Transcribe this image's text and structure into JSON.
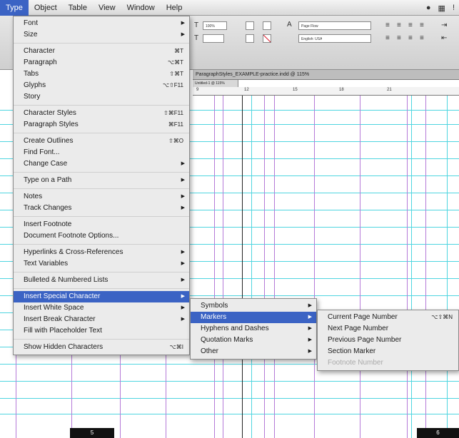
{
  "menubar": {
    "items": [
      "Type",
      "Object",
      "Table",
      "View",
      "Window",
      "Help"
    ],
    "active": "Type"
  },
  "control": {
    "size_value": "100%",
    "style_field": "Page Flow",
    "language_field": "English: USA"
  },
  "document": {
    "title": "ParagraphStyles_EXAMPLE-practice.indd @ 115%",
    "subtab": "Untitled-1 @ 115%",
    "ruler_numbers": [
      "9",
      "12",
      "15",
      "18",
      "21"
    ]
  },
  "pages": {
    "left_label": "5",
    "right_label": "6"
  },
  "type_menu": {
    "groups": [
      [
        {
          "label": "Font",
          "shortcut": "",
          "submenu": true
        },
        {
          "label": "Size",
          "shortcut": "",
          "submenu": true
        }
      ],
      [
        {
          "label": "Character",
          "shortcut": "⌘T",
          "submenu": false
        },
        {
          "label": "Paragraph",
          "shortcut": "⌥⌘T",
          "submenu": false
        },
        {
          "label": "Tabs",
          "shortcut": "⇧⌘T",
          "submenu": false
        },
        {
          "label": "Glyphs",
          "shortcut": "⌥⇧F11",
          "submenu": false
        },
        {
          "label": "Story",
          "shortcut": "",
          "submenu": false
        }
      ],
      [
        {
          "label": "Character Styles",
          "shortcut": "⇧⌘F11",
          "submenu": false
        },
        {
          "label": "Paragraph Styles",
          "shortcut": "⌘F11",
          "submenu": false
        }
      ],
      [
        {
          "label": "Create Outlines",
          "shortcut": "⇧⌘O",
          "submenu": false
        },
        {
          "label": "Find Font...",
          "shortcut": "",
          "submenu": false
        },
        {
          "label": "Change Case",
          "shortcut": "",
          "submenu": true
        }
      ],
      [
        {
          "label": "Type on a Path",
          "shortcut": "",
          "submenu": true
        }
      ],
      [
        {
          "label": "Notes",
          "shortcut": "",
          "submenu": true
        },
        {
          "label": "Track Changes",
          "shortcut": "",
          "submenu": true
        }
      ],
      [
        {
          "label": "Insert Footnote",
          "shortcut": "",
          "submenu": false
        },
        {
          "label": "Document Footnote Options...",
          "shortcut": "",
          "submenu": false
        }
      ],
      [
        {
          "label": "Hyperlinks & Cross-References",
          "shortcut": "",
          "submenu": true
        },
        {
          "label": "Text Variables",
          "shortcut": "",
          "submenu": true
        }
      ],
      [
        {
          "label": "Bulleted & Numbered Lists",
          "shortcut": "",
          "submenu": true
        }
      ],
      [
        {
          "label": "Insert Special Character",
          "shortcut": "",
          "submenu": true,
          "highlighted": true
        },
        {
          "label": "Insert White Space",
          "shortcut": "",
          "submenu": true
        },
        {
          "label": "Insert Break Character",
          "shortcut": "",
          "submenu": true
        },
        {
          "label": "Fill with Placeholder Text",
          "shortcut": "",
          "submenu": false
        }
      ],
      [
        {
          "label": "Show Hidden Characters",
          "shortcut": "⌥⌘I",
          "submenu": false
        }
      ]
    ]
  },
  "special_menu": {
    "items": [
      {
        "label": "Symbols",
        "submenu": true
      },
      {
        "label": "Markers",
        "submenu": true,
        "highlighted": true
      },
      {
        "label": "Hyphens and Dashes",
        "submenu": true
      },
      {
        "label": "Quotation Marks",
        "submenu": true
      },
      {
        "label": "Other",
        "submenu": true
      }
    ]
  },
  "markers_menu": {
    "items": [
      {
        "label": "Current Page Number",
        "shortcut": "⌥⇧⌘N",
        "disabled": false
      },
      {
        "label": "Next Page Number",
        "shortcut": "",
        "disabled": false
      },
      {
        "label": "Previous Page Number",
        "shortcut": "",
        "disabled": false
      },
      {
        "label": "Section Marker",
        "shortcut": "",
        "disabled": false
      },
      {
        "label": "Footnote Number",
        "shortcut": "",
        "disabled": true
      }
    ]
  },
  "colors": {
    "highlight": "#3b63c4",
    "guide_cyan": "#4fd5e0",
    "guide_purple": "#b57ad8"
  }
}
